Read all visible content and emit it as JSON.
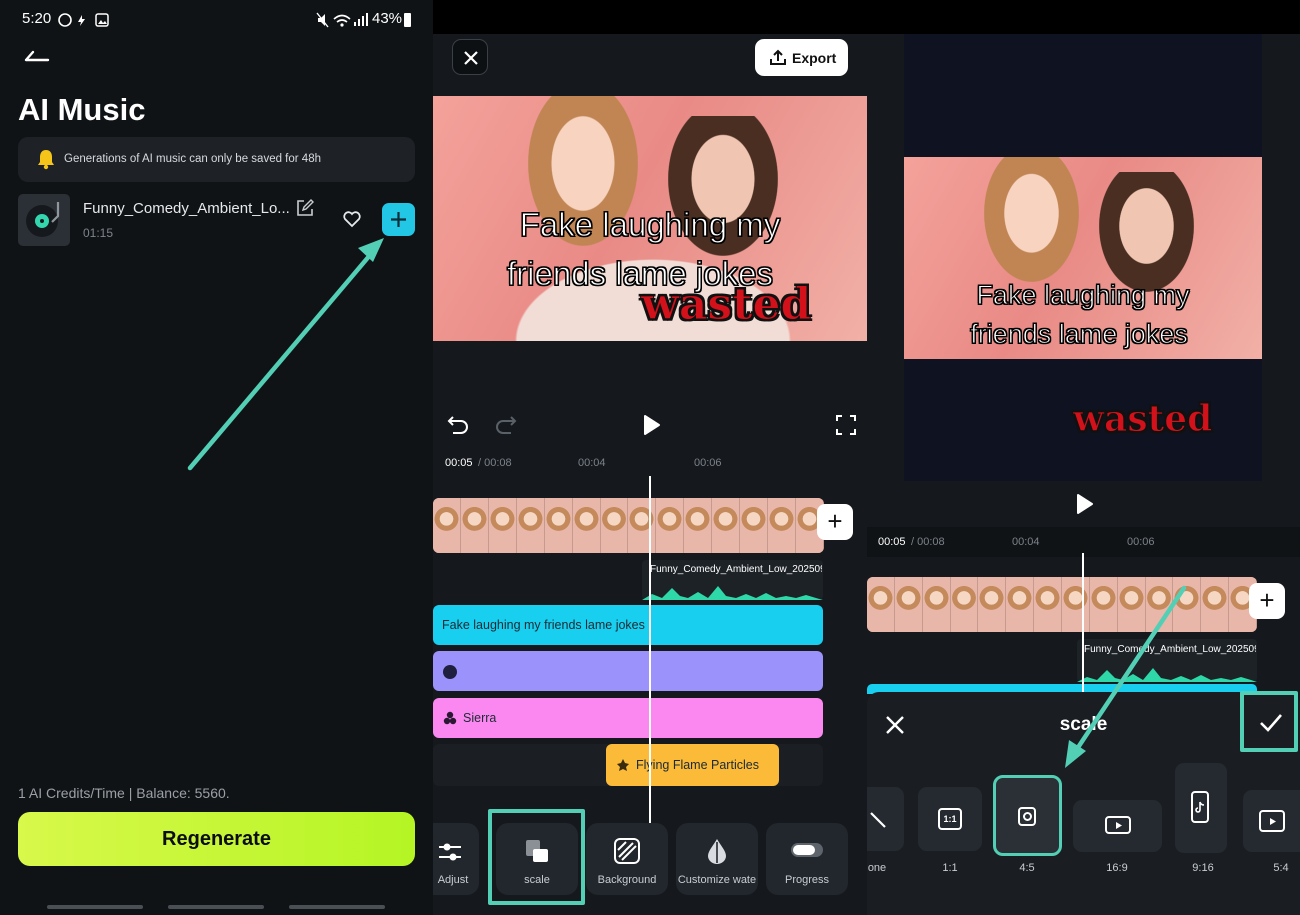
{
  "left_panel": {
    "status": {
      "time": "5:20",
      "battery": "43%"
    },
    "title": "AI Music",
    "notice": "Generations of AI music can only be saved for 48h",
    "music": {
      "name": "Funny_Comedy_Ambient_Lo...",
      "duration": "01:15"
    },
    "credits": "1 AI Credits/Time | Balance: 5560.",
    "regenerate_label": "Regenerate"
  },
  "middle_panel": {
    "export_label": "Export",
    "meme_text_line1": "Fake laughing my",
    "meme_text_line2": "friends lame jokes",
    "wasted_text": "wasted",
    "time": {
      "current": "00:05",
      "total": "/ 00:08",
      "mark1": "00:04",
      "mark2": "00:06"
    },
    "audio_clip_name": "Funny_Comedy_Ambient_Low_2025091",
    "tracks": {
      "text": "Fake laughing my friends lame jokes",
      "sticker": "",
      "filter": "Sierra",
      "effect": "Flying Flame Particles"
    },
    "tools": [
      {
        "label": "Adjust"
      },
      {
        "label": "scale"
      },
      {
        "label": "Background"
      },
      {
        "label": "Customize wate"
      },
      {
        "label": "Progress"
      }
    ]
  },
  "right_panel": {
    "meme_text_line1": "Fake laughing my",
    "meme_text_line2": "friends lame jokes",
    "wasted_text": "wasted",
    "time": {
      "current": "00:05",
      "total": "/ 00:08",
      "mark1": "00:04",
      "mark2": "00:06"
    },
    "audio_clip_name": "Funny_Comedy_Ambient_Low_2025091",
    "sheet_title": "scale",
    "ratios": [
      {
        "label": "one"
      },
      {
        "label": "1:1"
      },
      {
        "label": "4:5"
      },
      {
        "label": "16:9"
      },
      {
        "label": "9:16"
      },
      {
        "label": "5:4"
      }
    ],
    "ratio_icon_labels": {
      "r11": "1:1"
    }
  },
  "colors": {
    "accent_cyan": "#22c7e6",
    "highlight_teal": "#53cfb5",
    "regenerate_green": "#c9f83a",
    "text_track": "#19cff0",
    "sticker_track": "#9c92fb",
    "filter_track": "#fb88f0",
    "effect_track": "#fbbb39"
  }
}
